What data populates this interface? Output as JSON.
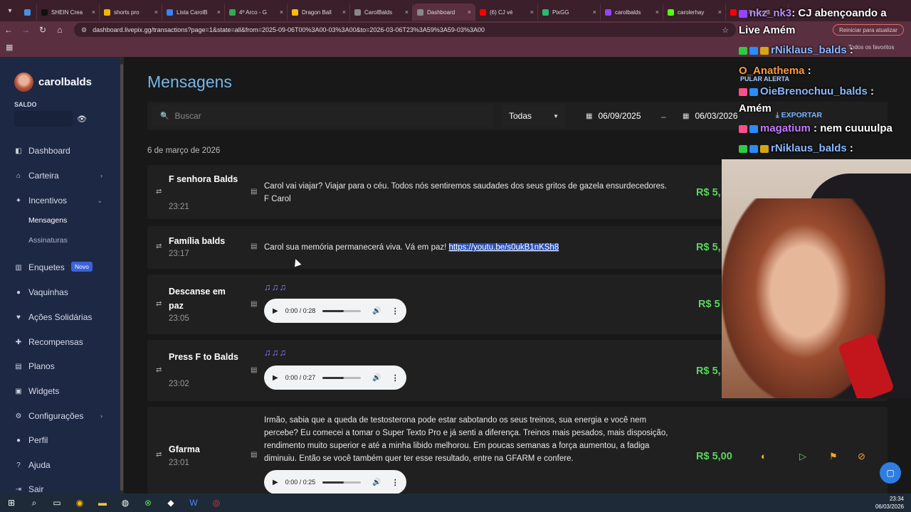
{
  "browser": {
    "tabs": [
      {
        "label": "",
        "icon": "shield-icon",
        "color": "#4a90e2"
      },
      {
        "label": "SHEIN Crea",
        "icon": "shein-icon",
        "color": "#111111"
      },
      {
        "label": "shorts pro",
        "icon": "drive-icon",
        "color": "#f5b400"
      },
      {
        "label": "Lista CarolB",
        "icon": "cloud-icon",
        "color": "#3b82f6"
      },
      {
        "label": "4º Arco - G",
        "icon": "drive-icon",
        "color": "#34a853"
      },
      {
        "label": "Dragon Ball",
        "icon": "drive-icon",
        "color": "#fbbc05"
      },
      {
        "label": "CarolBalds",
        "icon": "globe-icon",
        "color": "#888888"
      },
      {
        "label": "Dashboard",
        "icon": "globe-icon",
        "color": "#888888"
      },
      {
        "label": "(6) CJ vé",
        "icon": "youtube-icon",
        "color": "#ff0000"
      },
      {
        "label": "PixGG",
        "icon": "pix-icon",
        "color": "#2bb673"
      },
      {
        "label": "carolbalds",
        "icon": "twitch-icon",
        "color": "#9146ff"
      },
      {
        "label": "carolerhay",
        "icon": "kick-icon",
        "color": "#53fc18"
      },
      {
        "label": "(6) Rocky B",
        "icon": "youtube-icon",
        "color": "#ff0000"
      }
    ],
    "url": "dashboard.livepix.gg/transactions?page=1&state=all&from=2025-09-06T00%3A00-03%3A00&to=2026-03-06T23%3A59%3A59-03%3A00",
    "update_button": "Reiniciar para atualizar",
    "all_bookmarks": "Todos os favoritos"
  },
  "sidebar": {
    "username": "carolbalds",
    "saldo_label": "SALDO",
    "items": [
      {
        "label": "Dashboard",
        "icon": "dashboard-icon"
      },
      {
        "label": "Carteira",
        "icon": "bank-icon"
      },
      {
        "label": "Incentivos",
        "icon": "tools-icon"
      },
      {
        "label": "Mensagens",
        "icon": ""
      },
      {
        "label": "Assinaturas",
        "icon": ""
      },
      {
        "label": "Enquetes",
        "icon": "poll-icon",
        "badge": "Novo"
      },
      {
        "label": "Vaquinhas",
        "icon": "piggy-icon"
      },
      {
        "label": "Ações Solidárias",
        "icon": "heart-icon"
      },
      {
        "label": "Recompensas",
        "icon": "gift-icon"
      },
      {
        "label": "Planos",
        "icon": "list-icon"
      },
      {
        "label": "Widgets",
        "icon": "widget-icon"
      },
      {
        "label": "Configurações",
        "icon": "gear-icon"
      },
      {
        "label": "Perfil",
        "icon": "user-icon"
      },
      {
        "label": "Ajuda",
        "icon": "help-icon"
      },
      {
        "label": "Sair",
        "icon": "logout-icon"
      }
    ]
  },
  "main": {
    "title": "Mensagens",
    "search_placeholder": "Buscar",
    "filter_value": "Todas",
    "date_from": "06/09/2025",
    "date_sep": "–",
    "date_to": "06/03/2026",
    "export_label": "EXPORTAR",
    "day_label": "6 de março de 2026",
    "rows": [
      {
        "name": "F senhora Balds",
        "time": "23:21",
        "message": "Carol vai viajar? Viajar para o céu. Todos nós sentiremos saudades dos seus gritos de gazela ensurdecedores. F Carol",
        "amount": "R$ 5,"
      },
      {
        "name": "Família balds",
        "time": "23:17",
        "message": "Carol sua memória permanecerá viva. Vá em paz! ",
        "link": "https://youtu.be/s0ukB1nKSh8",
        "amount": "R$ 5,"
      },
      {
        "name": "Descanse em paz",
        "time": "23:05",
        "notes": "♫♫♫",
        "audio_time": "0:00 / 0:28",
        "amount": "R$ 5"
      },
      {
        "name": "Press F to Balds",
        "time": "23:02",
        "notes": "♫♫♫",
        "audio_time": "0:00 / 0:27",
        "amount": "R$ 5,"
      },
      {
        "name": "Gfarma",
        "time": "23:01",
        "message": "Irmão, sabia que a queda de testosterona pode estar sabotando os seus treinos, sua energia e você nem percebe? Eu comecei a tomar o Super Texto Pro e já senti a diferença. Treinos mais pesados, mais disposição, rendimento muito superior e até a minha libido melhorou. Em poucas semanas a força aumentou, a fadiga diminuiu. Então se você também quer ter esse resultado, entre na GFARM e confere.",
        "audio_time": "0:00 / 0:25",
        "amount": "R$ 5,00"
      }
    ]
  },
  "overlay": {
    "chat": [
      {
        "user": "nkz_nk3",
        "text": ": CJ abençoando a",
        "color": "#b98cff"
      },
      {
        "user": "",
        "text": "Live Amém",
        "color": "#ffffff"
      },
      {
        "user": "rNiklaus_balds",
        "text": " :",
        "color": "#8ab8ff"
      },
      {
        "user": "O_Anathema",
        "text": " :",
        "color": "#ff9a3c"
      },
      {
        "user": "OieBrenochuu_balds",
        "text": " :",
        "color": "#8ab8ff"
      },
      {
        "user": "",
        "text": "Amém",
        "color": "#ffffff"
      },
      {
        "user": "magatium",
        "text": " : nem cuuuulpa",
        "color": "#c37bff"
      },
      {
        "user": "rNiklaus_balds",
        "text": " :",
        "color": "#8ab8ff"
      }
    ],
    "alert_skip": "PULAR ALERTA"
  },
  "taskbar": {
    "time": "23:34",
    "date": "06/03/2026"
  }
}
